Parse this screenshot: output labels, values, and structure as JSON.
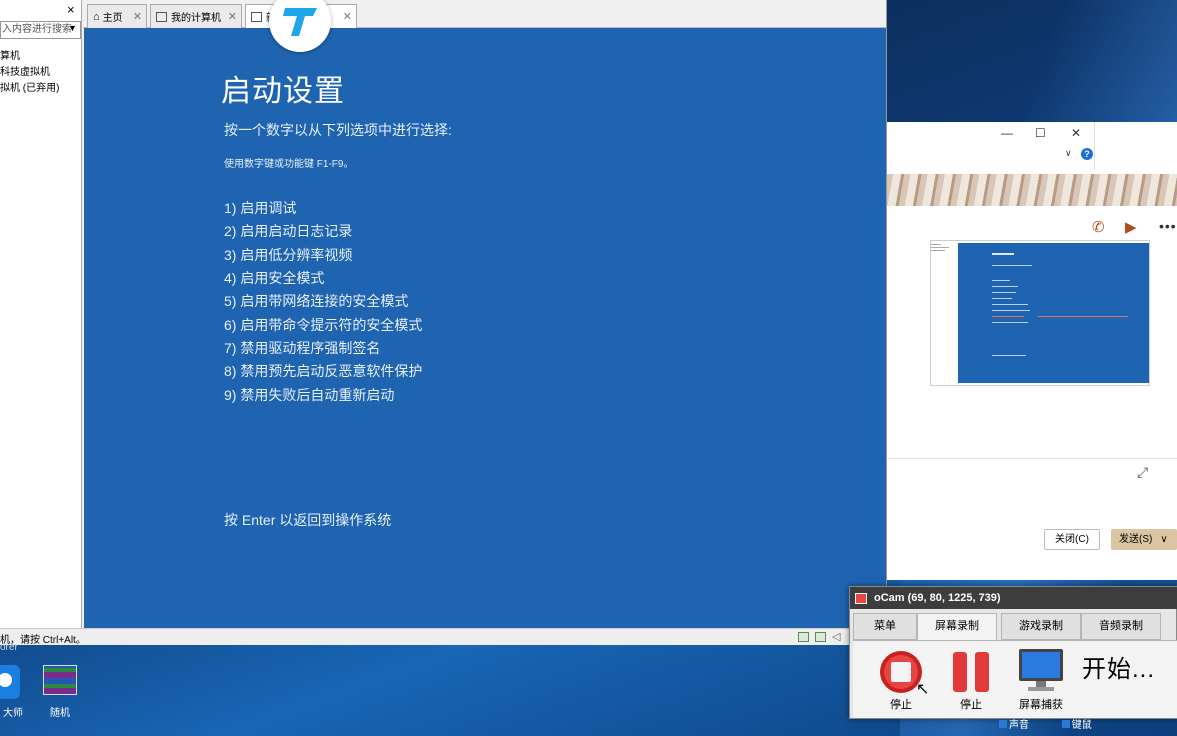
{
  "sidebar": {
    "close": "×",
    "search_placeholder": "入内容进行搜索",
    "tree": [
      "算机",
      "科技虚拟机",
      "拟机 (已弃用)"
    ]
  },
  "tabs": [
    {
      "label": "主页",
      "icon": "home-icon"
    },
    {
      "label": "我的计算机",
      "icon": "monitor-icon"
    },
    {
      "label": "新",
      "tail": "机",
      "icon": "vm-icon"
    }
  ],
  "vm_screen": {
    "heading": "启动设置",
    "prompt": "按一个数字以从下列选项中进行选择:",
    "hint": "使用数字键或功能键 F1-F9。",
    "options": [
      "1) 启用调试",
      "2) 启用启动日志记录",
      "3) 启用低分辨率视频",
      "4) 启用安全模式",
      "5) 启用带网络连接的安全模式",
      "6) 启用带命令提示符的安全模式",
      "7) 禁用驱动程序强制签名",
      "8) 禁用预先启动反恶意软件保护",
      "9) 禁用失败后自动重新启动"
    ],
    "enter_hint": "按 Enter 以返回到操作系统"
  },
  "statusbar": {
    "text": "机，请按 Ctrl+Alt。"
  },
  "chat": {
    "minimize": "—",
    "maximize": "☐",
    "close": "✕",
    "help": "?",
    "close_button": "关闭(C)",
    "send_button": "发送(S)"
  },
  "desktop": {
    "top_label": "orer",
    "icons": [
      {
        "label": "大师",
        "icon": "app-avatar-icon"
      },
      {
        "label": "随机",
        "icon": "winrar-icon"
      }
    ]
  },
  "ocam": {
    "title": "oCam (69, 80, 1225, 739)",
    "tabs": [
      "菜单",
      "屏幕录制",
      "游戏录制",
      "音频录制"
    ],
    "active_tab": "屏幕录制",
    "stop_label": "停止",
    "pause_label": "停止",
    "capture_label": "屏幕捕获",
    "status_text": "开始...",
    "bottom_options": [
      "声音",
      "键鼠"
    ]
  },
  "colors": {
    "vm_blue": "#1f64b0",
    "ocam_title": "#3d3d3d",
    "send_button": "#dac4a2"
  }
}
